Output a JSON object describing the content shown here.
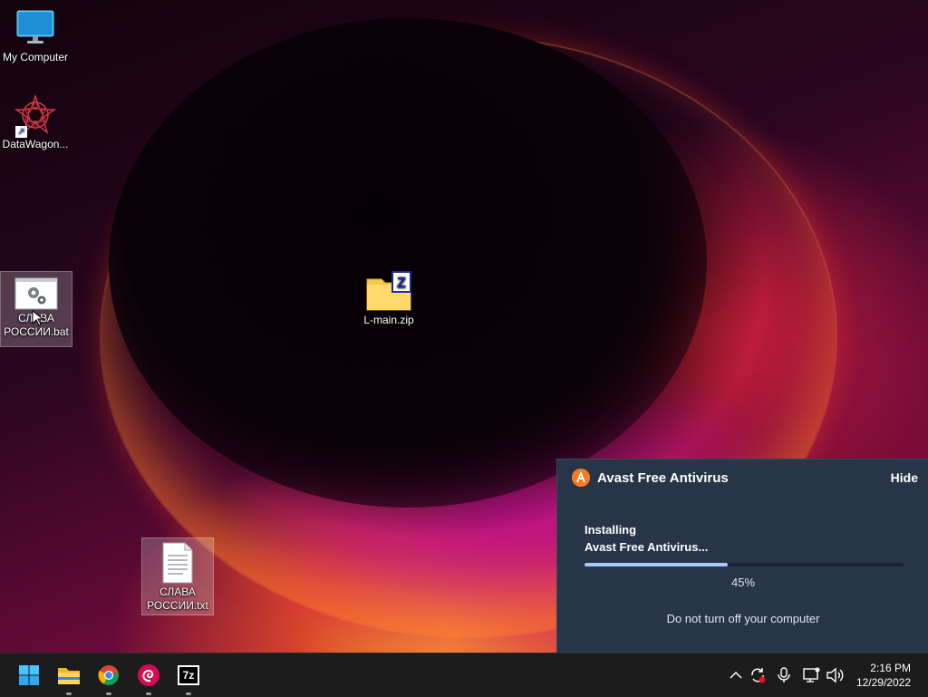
{
  "desktop": {
    "icons": [
      {
        "label": "My Computer"
      },
      {
        "label": "DataWagon..."
      },
      {
        "label_line1": "СЛАВА",
        "label_line2": "РОССИИ.bat"
      },
      {
        "label": "L-main.zip"
      },
      {
        "label_line1": "СЛАВА",
        "label_line2": "РОССИИ.txt"
      }
    ]
  },
  "avast_popup": {
    "title": "Avast Free Antivirus",
    "hide_label": "Hide",
    "status_line1": "Installing",
    "status_line2": "Avast Free Antivirus...",
    "progress_fraction": 0.45,
    "progress_text": "45%",
    "note": "Do not turn off your computer",
    "accent_color": "#f57c22"
  },
  "taskbar": {
    "apps": [
      {
        "name": "start-menu",
        "icon": "windows-icon"
      },
      {
        "name": "file-explorer",
        "icon": "folder-icon",
        "running": true
      },
      {
        "name": "chrome",
        "icon": "chrome-icon",
        "running": true
      },
      {
        "name": "debian",
        "icon": "debian-swirl-icon",
        "running": true
      },
      {
        "name": "7-zip",
        "icon": "7zip-icon",
        "running": true
      }
    ],
    "app_7z_label": "7z",
    "tray": {
      "time": "2:16 PM",
      "date": "12/29/2022"
    }
  }
}
